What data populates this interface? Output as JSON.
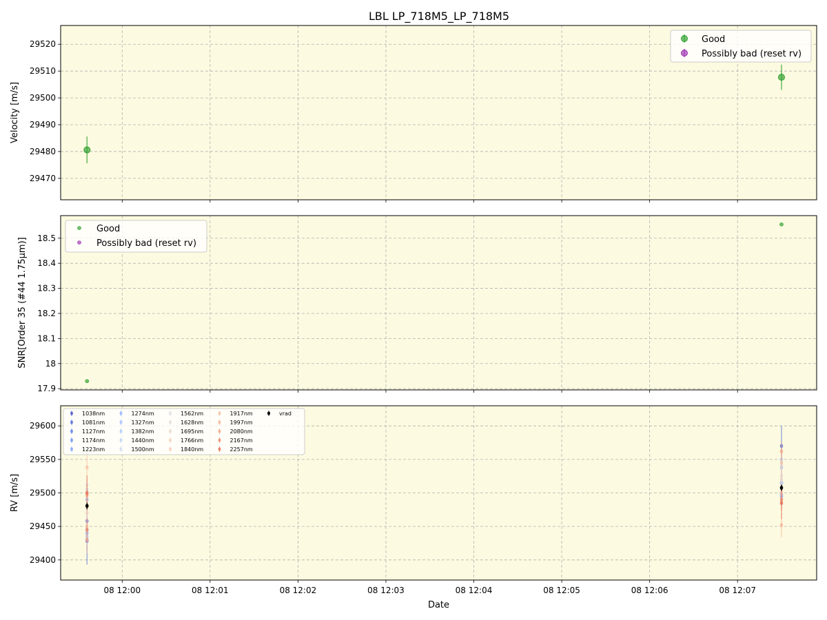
{
  "title": "LBL LP_718M5_LP_718M5",
  "colors": {
    "panel_bg": "#fcfae0",
    "good": "#2ca02c",
    "bad": "#9b30b0",
    "grid": "#b0b0b0",
    "vrad": "#000000"
  },
  "chart_data": [
    {
      "type": "scatter",
      "name": "velocity",
      "ylabel": "Velocity [m/s]",
      "xlabel": "",
      "ylim": [
        29462,
        29527
      ],
      "yticks": [
        29470,
        29480,
        29490,
        29500,
        29510,
        29520
      ],
      "grid": true,
      "legend_position": "top-right",
      "legend": [
        "Good",
        "Possibly bad (reset rv)"
      ],
      "series": [
        {
          "name": "Good",
          "points": [
            {
              "x": "11:59:36",
              "y": 29480.6,
              "err": 5.0
            },
            {
              "x": "12:07:30",
              "y": 29507.7,
              "err": 4.7
            }
          ]
        },
        {
          "name": "Possibly bad (reset rv)",
          "points": []
        }
      ]
    },
    {
      "type": "scatter",
      "name": "snr",
      "ylabel": "SNR[Order 35 (#44 1.75μm)]",
      "xlabel": "",
      "ylim": [
        17.895,
        18.59
      ],
      "yticks": [
        17.9,
        18.0,
        18.1,
        18.2,
        18.3,
        18.4,
        18.5
      ],
      "grid": true,
      "legend_position": "top-left",
      "legend": [
        "Good",
        "Possibly bad (reset rv)"
      ],
      "series": [
        {
          "name": "Good",
          "points": [
            {
              "x": "11:59:36",
              "y": 17.93
            },
            {
              "x": "12:07:30",
              "y": 18.555
            }
          ]
        },
        {
          "name": "Possibly bad (reset rv)",
          "points": []
        }
      ]
    },
    {
      "type": "scatter",
      "name": "rv",
      "ylabel": "RV [m/s]",
      "xlabel": "Date",
      "ylim": [
        29370,
        29630
      ],
      "yticks": [
        29400,
        29450,
        29500,
        29550,
        29600
      ],
      "xticks": [
        "08 12:00",
        "08 12:01",
        "08 12:02",
        "08 12:03",
        "08 12:04",
        "08 12:05",
        "08 12:06",
        "08 12:07"
      ],
      "grid": true,
      "legend_position": "top-left",
      "x_obs": [
        "11:59:36",
        "12:07:30"
      ],
      "series": [
        {
          "name": "1038nm",
          "color": "#3b4cc0",
          "y": [
            29430,
            29515
          ],
          "err": [
            14,
            12
          ]
        },
        {
          "name": "1081nm",
          "color": "#4a63d3",
          "y": [
            29428,
            29570
          ],
          "err": [
            35,
            30
          ]
        },
        {
          "name": "1127nm",
          "color": "#5a78e4",
          "y": [
            29458,
            29498
          ],
          "err": [
            16,
            14
          ]
        },
        {
          "name": "1174nm",
          "color": "#6b8df0",
          "y": [
            29490,
            29495
          ],
          "err": [
            16,
            14
          ]
        },
        {
          "name": "1223nm",
          "color": "#7b9ff9",
          "y": [
            29440,
            29515
          ],
          "err": [
            16,
            14
          ]
        },
        {
          "name": "1274nm",
          "color": "#8db0fe",
          "y": [
            29445,
            29538
          ],
          "err": [
            14,
            13
          ]
        },
        {
          "name": "1327nm",
          "color": "#9ebeff",
          "y": [
            29430,
            29495
          ],
          "err": [
            14,
            13
          ]
        },
        {
          "name": "1382nm",
          "color": "#aec9fc",
          "y": [
            29435,
            29550
          ],
          "err": [
            14,
            13
          ]
        },
        {
          "name": "1440nm",
          "color": "#bfd3f6",
          "y": [
            29490,
            29498
          ],
          "err": [
            14,
            13
          ]
        },
        {
          "name": "1500nm",
          "color": "#cdd9ec",
          "y": [
            29505,
            29515
          ],
          "err": [
            14,
            13
          ]
        },
        {
          "name": "1562nm",
          "color": "#d9dce1",
          "y": [
            29512,
            29540
          ],
          "err": [
            14,
            13
          ]
        },
        {
          "name": "1628nm",
          "color": "#e3d9d3",
          "y": [
            29495,
            29525
          ],
          "err": [
            14,
            13
          ]
        },
        {
          "name": "1695nm",
          "color": "#ead4c8",
          "y": [
            29500,
            29520
          ],
          "err": [
            14,
            13
          ]
        },
        {
          "name": "1766nm",
          "color": "#f1cdba",
          "y": [
            29470,
            29485
          ],
          "err": [
            14,
            13
          ]
        },
        {
          "name": "1840nm",
          "color": "#f4c5ad",
          "y": [
            29450,
            29500
          ],
          "err": [
            14,
            13
          ]
        },
        {
          "name": "1917nm",
          "color": "#f6bda2",
          "y": [
            29538,
            29545
          ],
          "err": [
            22,
            20
          ]
        },
        {
          "name": "1997nm",
          "color": "#f5b194",
          "y": [
            29430,
            29452
          ],
          "err": [
            20,
            18
          ]
        },
        {
          "name": "2080nm",
          "color": "#f3a481",
          "y": [
            29497,
            29562
          ],
          "err": [
            16,
            14
          ]
        },
        {
          "name": "2167nm",
          "color": "#ee8468",
          "y": [
            29445,
            29490
          ],
          "err": [
            18,
            16
          ]
        },
        {
          "name": "2257nm",
          "color": "#e36c55",
          "y": [
            29500,
            29485
          ],
          "err": [
            26,
            24
          ]
        },
        {
          "name": "vrad",
          "color": "#000000",
          "y": [
            29480.6,
            29507.7
          ],
          "err": [
            5,
            4.7
          ]
        }
      ]
    }
  ]
}
